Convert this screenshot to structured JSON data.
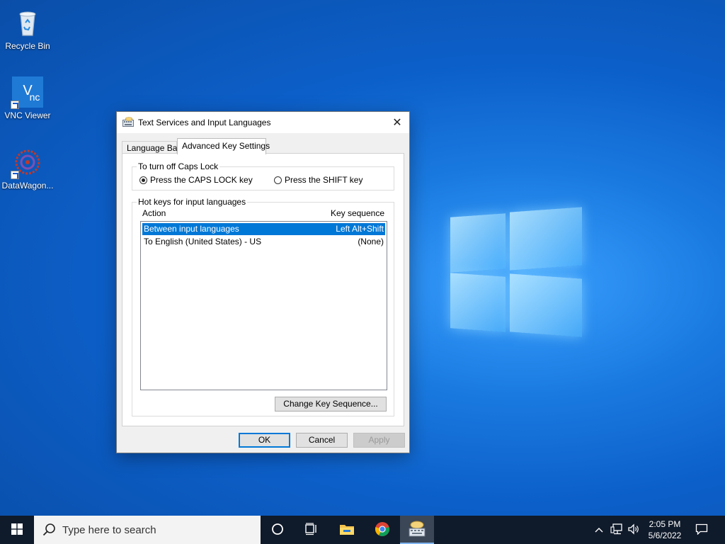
{
  "desktop": {
    "icons": [
      {
        "label": "Recycle Bin"
      },
      {
        "label": "VNC Viewer"
      },
      {
        "label": "DataWagon..."
      }
    ]
  },
  "dialog": {
    "title": "Text Services and Input Languages",
    "tabs": [
      {
        "label": "Language Bar",
        "active": false
      },
      {
        "label": "Advanced Key Settings",
        "active": true
      }
    ],
    "caps_lock": {
      "group_title": "To turn off Caps Lock",
      "options": [
        {
          "label": "Press the CAPS LOCK key",
          "selected": true
        },
        {
          "label": "Press the SHIFT key",
          "selected": false
        }
      ]
    },
    "hotkeys": {
      "group_title": "Hot keys for input languages",
      "col_action": "Action",
      "col_key": "Key sequence",
      "rows": [
        {
          "action": "Between input languages",
          "key": "Left Alt+Shift",
          "selected": true
        },
        {
          "action": "To English (United States) - US",
          "key": "(None)",
          "selected": false
        }
      ],
      "change_button": "Change Key Sequence..."
    },
    "buttons": {
      "ok": "OK",
      "cancel": "Cancel",
      "apply": "Apply"
    }
  },
  "taskbar": {
    "search_placeholder": "Type here to search",
    "time": "2:05 PM",
    "date": "5/6/2022"
  },
  "colors": {
    "accent": "#0078d7",
    "taskbar": "#0f1a2a"
  }
}
